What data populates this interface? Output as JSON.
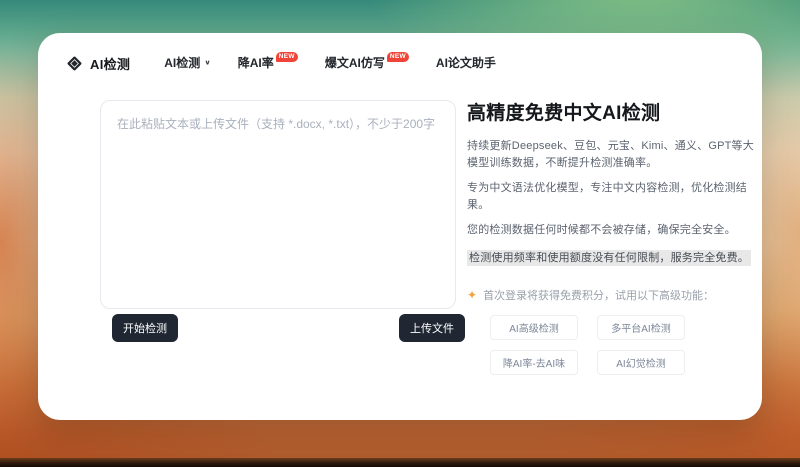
{
  "nav": {
    "logo_text": "AI检测",
    "items": [
      {
        "label": "AI检测"
      },
      {
        "label": "降AI率",
        "badge": "NEW"
      },
      {
        "label": "爆文AI仿写",
        "badge": "NEW"
      },
      {
        "label": "AI论文助手"
      }
    ]
  },
  "editor": {
    "placeholder": "在此粘贴文本或上传文件（支持 *.docx, *.txt），不少于200字",
    "start_button": "开始检测",
    "upload_button": "上传文件"
  },
  "info": {
    "title": "高精度免费中文AI检测",
    "paragraphs": [
      "持续更新Deepseek、豆包、元宝、Kimi、通义、GPT等大模型训练数据，不断提升检测准确率。",
      "专为中文语法优化模型，专注中文内容检测，优化检测结果。",
      "您的检测数据任何时候都不会被存储，确保完全安全。"
    ],
    "highlight": "检测使用频率和使用额度没有任何限制，服务完全免费。",
    "promo": "首次登录将获得免费积分，试用以下高级功能：",
    "features": [
      "AI高级检测",
      "多平台AI检测",
      "降AI率-去AI味",
      "AI幻觉检测"
    ]
  },
  "colors": {
    "badge_red": "#f04438",
    "dark_button": "#202733",
    "sparkle_orange": "#f2a33c",
    "highlight_bg": "#e8e8e8",
    "bg_teal": "#35897a",
    "bg_orange": "#bb6333"
  }
}
